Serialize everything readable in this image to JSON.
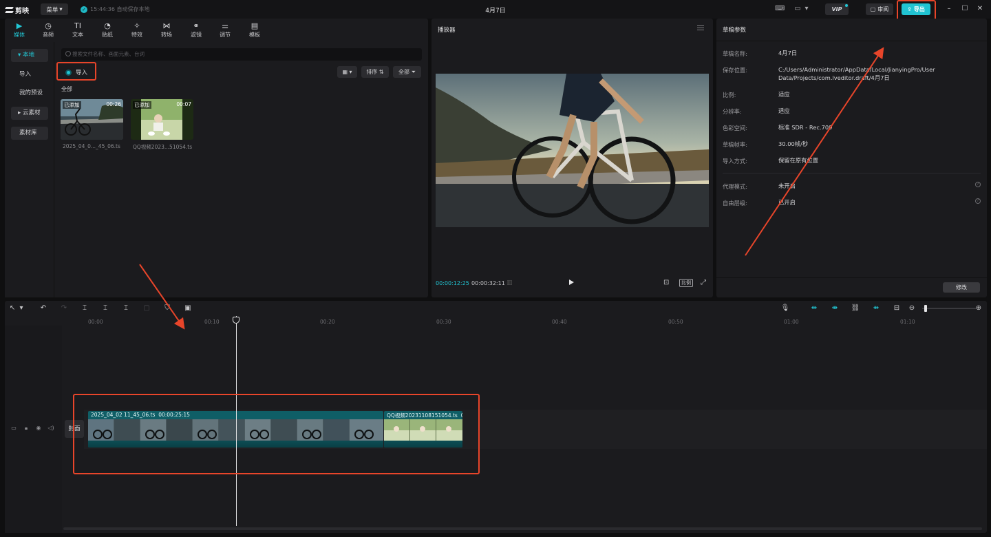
{
  "titlebar": {
    "app_name": "剪映",
    "menu_label": "菜单",
    "save_status": "15:44:36 自动保存本地",
    "doc_title": "4月7日",
    "vip_label": "VIP",
    "review_label": "审阅",
    "export_label": "导出"
  },
  "media": {
    "tabs": [
      {
        "label": "媒体",
        "icon": "media-icon",
        "active": true
      },
      {
        "label": "音频",
        "icon": "audio-icon"
      },
      {
        "label": "文本",
        "icon": "text-icon"
      },
      {
        "label": "贴纸",
        "icon": "sticker-icon"
      },
      {
        "label": "特效",
        "icon": "effects-icon"
      },
      {
        "label": "转场",
        "icon": "transition-icon"
      },
      {
        "label": "滤镜",
        "icon": "filter-icon"
      },
      {
        "label": "调节",
        "icon": "adjust-icon"
      },
      {
        "label": "模板",
        "icon": "template-icon"
      }
    ],
    "sidebar": [
      {
        "label": "本地",
        "active": true
      },
      {
        "label": "导入"
      },
      {
        "label": "我的预设"
      },
      {
        "label": "云素材"
      },
      {
        "label": "素材库"
      }
    ],
    "search_placeholder": "搜索文件名称、画面元素、台词",
    "import_label": "导入",
    "sort_label": "排序",
    "filter_label": "全部",
    "section_label": "全部",
    "items": [
      {
        "badge": "已添加",
        "duration": "00:26",
        "name": "2025_04_0..._45_06.ts"
      },
      {
        "badge": "已添加",
        "duration": "00:07",
        "name": "QQ视频2023...51054.ts"
      }
    ]
  },
  "player": {
    "title": "播放器",
    "current_time": "00:00:12:25",
    "total_time": "00:00:32:11",
    "ratio_label": "比例"
  },
  "props": {
    "title": "草稿参数",
    "rows": [
      {
        "key": "草稿名称:",
        "value": "4月7日"
      },
      {
        "key": "保存位置:",
        "value": "C:/Users/Administrator/AppData/Local/JianyingPro/User Data/Projects/com.lveditor.draft/4月7日"
      },
      {
        "key": "比例:",
        "value": "适应"
      },
      {
        "key": "分辨率:",
        "value": "适应"
      },
      {
        "key": "色彩空间:",
        "value": "标准 SDR - Rec.709"
      },
      {
        "key": "草稿帧率:",
        "value": "30.00帧/秒"
      },
      {
        "key": "导入方式:",
        "value": "保留在原有位置"
      },
      {
        "key": "代理模式:",
        "value": "未开启"
      },
      {
        "key": "自由层级:",
        "value": "已开启"
      }
    ],
    "edit_label": "修改"
  },
  "timeline": {
    "ticks": [
      "00:00",
      "00:10",
      "00:20",
      "00:30",
      "00:40",
      "00:50",
      "01:00",
      "01:10"
    ],
    "cover_label": "封面",
    "clips": [
      {
        "name": "2025_04_02 11_45_06.ts",
        "duration": "00:00:25:15"
      },
      {
        "name": "QQ视频20231108151054.ts",
        "duration": "00"
      }
    ]
  },
  "colors": {
    "accent": "#22c6d4",
    "annotation": "#e8452a",
    "clip": "#0f5e66"
  }
}
